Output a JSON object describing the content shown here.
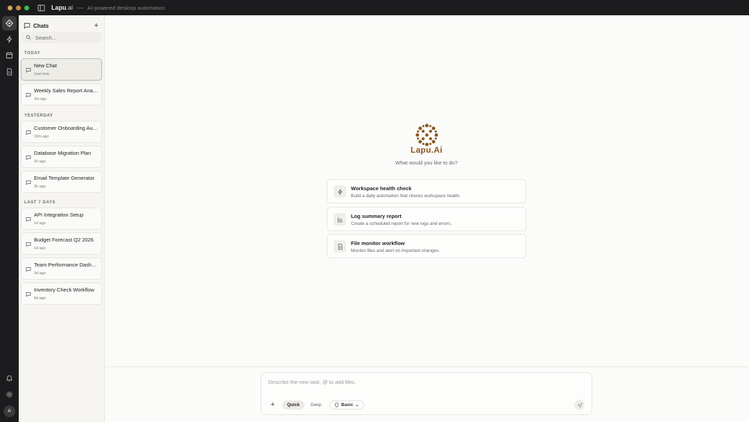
{
  "window": {
    "app_name": "Lapu",
    "app_name_suffix": ".ai",
    "separator": "—",
    "subtitle": "AI-powered desktop automation",
    "traffic_colors": [
      "#d7a15a",
      "#c98a3e",
      "#3fbb4c"
    ]
  },
  "rail": {
    "items": [
      "logo-icon",
      "lightning-icon",
      "calendar-icon",
      "document-icon"
    ],
    "bottom": [
      "bell-icon",
      "gear-icon"
    ],
    "avatar": "A"
  },
  "sidebar": {
    "title": "Chats",
    "new_label": "+",
    "search_placeholder": "Search...",
    "groups": [
      {
        "label": "TODAY",
        "chats": [
          {
            "title": "New Chat",
            "time": "Just now",
            "active": true
          },
          {
            "title": "Weekly Sales Report Analysis",
            "time": "2m ago"
          }
        ]
      },
      {
        "label": "YESTERDAY",
        "chats": [
          {
            "title": "Customer Onboarding Automation",
            "time": "15m ago"
          },
          {
            "title": "Database Migration Plan",
            "time": "1h ago"
          },
          {
            "title": "Email Template Generator",
            "time": "3h ago"
          }
        ]
      },
      {
        "label": "LAST 7 DAYS",
        "chats": [
          {
            "title": "API Integration Setup",
            "time": "1d ago"
          },
          {
            "title": "Budget Forecast Q2 2026",
            "time": "1d ago"
          },
          {
            "title": "Team Performance Dashboard",
            "time": "3d ago"
          },
          {
            "title": "Inventory Check Workflow",
            "time": "5d ago"
          }
        ]
      }
    ]
  },
  "main": {
    "brand": "Lapu.Ai",
    "brand_color": "#8a5a22",
    "prompt": "What would you like to do?",
    "suggestions": [
      {
        "icon": "lightning-icon",
        "title": "Workspace health check",
        "desc": "Build a daily automation that checks workspace health."
      },
      {
        "icon": "chart-icon",
        "title": "Log summary report",
        "desc": "Create a scheduled report for new logs and errors."
      },
      {
        "icon": "file-icon",
        "title": "File monitor workflow",
        "desc": "Monitor files and alert on important changes."
      }
    ]
  },
  "composer": {
    "placeholder": "Describe the new task, @ to add files.",
    "plus": "+",
    "modes": [
      "Quick",
      "Deep"
    ],
    "selected_mode": "Quick",
    "level": "Basic"
  }
}
